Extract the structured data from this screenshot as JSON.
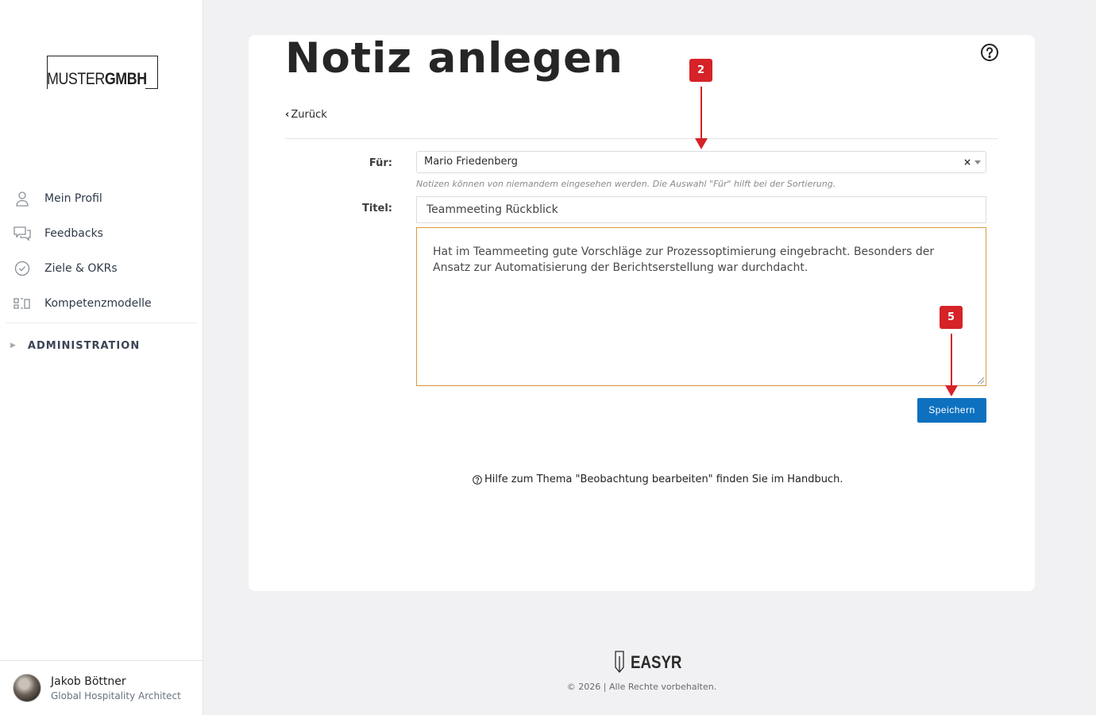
{
  "company": {
    "logo_text_light": "MUSTER",
    "logo_text_bold": "GMBH"
  },
  "sidebar": {
    "items": [
      {
        "label": "Mein Profil",
        "icon": "person-icon"
      },
      {
        "label": "Feedbacks",
        "icon": "chat-bubbles-icon"
      },
      {
        "label": "Ziele & OKRs",
        "icon": "check-circle-icon"
      },
      {
        "label": "Kompetenzmodelle",
        "icon": "competency-icon"
      }
    ],
    "admin_label": "ADMINISTRATION"
  },
  "user": {
    "name": "Jakob Böttner",
    "role": "Global Hospitality Architect"
  },
  "page": {
    "title": "Notiz anlegen",
    "back_label": "Zurück",
    "for_label": "Für:",
    "for_value": "Mario Friedenberg",
    "for_clear": "×",
    "hint": "Notizen können von niemandem eingesehen werden. Die Auswahl \"Für\" hilft bei der Sortierung.",
    "title_label": "Titel:",
    "title_value": "Teammeeting Rückblick",
    "body_value": "Hat im Teammeeting gute Vorschläge zur Prozessoptimierung eingebracht. Besonders der Ansatz zur Automatisierung der Berichtserstellung war durchdacht.",
    "save_label": "Speichern",
    "help_text": "Hilfe zum Thema \"Beobachtung bearbeiten\" finden Sie im Handbuch."
  },
  "annotations": [
    {
      "number": "2",
      "color": "#d52328"
    },
    {
      "number": "5",
      "color": "#d52328"
    }
  ],
  "footer": {
    "brand": "EASYR",
    "copyright": "© 2026 | Alle Rechte vorbehalten."
  },
  "colors": {
    "primary": "#0d71c0",
    "annotation": "#d52328",
    "focus_border": "#d89b3a"
  }
}
